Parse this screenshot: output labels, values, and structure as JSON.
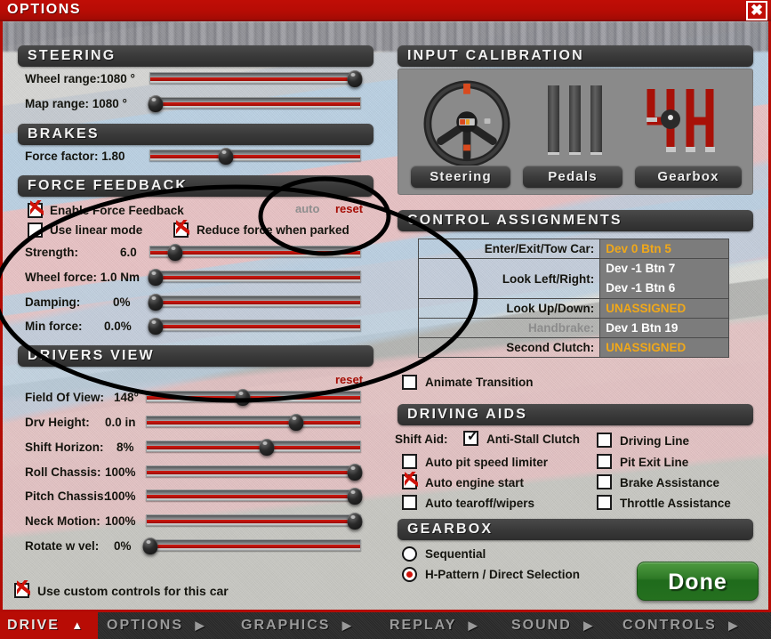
{
  "window": {
    "title": "OPTIONS",
    "close_label": "✖"
  },
  "steering": {
    "header": "STEERING",
    "rows": [
      {
        "label": "Wheel range:1080 °",
        "value": 100
      },
      {
        "label": "Map range:   1080 °",
        "value": 2
      }
    ]
  },
  "brakes": {
    "header": "BRAKES",
    "rows": [
      {
        "label": "Force factor:   1.80",
        "value": 38
      }
    ]
  },
  "force_feedback": {
    "header": "FORCE FEEDBACK",
    "auto_label": "auto",
    "reset_label": "reset",
    "checkboxes": [
      {
        "label": "Enable Force Feedback",
        "checked": true
      },
      {
        "label": "Use linear mode",
        "checked": false
      },
      {
        "label": "Reduce force when parked",
        "checked": true
      }
    ],
    "rows": [
      {
        "label": "Strength:",
        "value_text": "6.0",
        "value": 13
      },
      {
        "label": "Wheel force: 1.0 Nm",
        "value_text": "",
        "value": 2
      },
      {
        "label": "Damping:",
        "value_text": "0%",
        "value": 2
      },
      {
        "label": "Min force:",
        "value_text": "0.0%",
        "value": 2
      }
    ]
  },
  "drivers_view": {
    "header": "DRIVERS VIEW",
    "reset_label": "reset",
    "rows": [
      {
        "label": "Field Of View:",
        "value_text": "148°",
        "value": 45
      },
      {
        "label": "Drv Height:",
        "value_text": "0.0 in",
        "value": 71
      },
      {
        "label": "Shift Horizon:",
        "value_text": "8%",
        "value": 57
      },
      {
        "label": "Roll Chassis:",
        "value_text": "100%",
        "value": 99
      },
      {
        "label": "Pitch Chassis:",
        "value_text": "100%",
        "value": 99
      },
      {
        "label": "Neck Motion:",
        "value_text": "100%",
        "value": 99
      },
      {
        "label": "Rotate w vel:",
        "value_text": "0%",
        "value": 2
      }
    ]
  },
  "custom_controls": {
    "label": "Use custom controls for this car",
    "checked": true
  },
  "input_calibration": {
    "header": "INPUT CALIBRATION",
    "buttons": [
      {
        "label": "Steering",
        "icon": "steering-wheel-icon"
      },
      {
        "label": "Pedals",
        "icon": "pedals-icon"
      },
      {
        "label": "Gearbox",
        "icon": "gearbox-h-pattern-icon"
      }
    ]
  },
  "control_assignments": {
    "header": "CONTROL ASSIGNMENTS",
    "rows": [
      {
        "key": "Enter/Exit/Tow Car:",
        "value": "Dev 0 Btn 5",
        "style": "highlight",
        "key_dim": false
      },
      {
        "key": "Look Left/Right:",
        "value": "Dev -1 Btn 7",
        "value2": "Dev -1 Btn 6",
        "style": "normal",
        "key_dim": false
      },
      {
        "key": "Look Up/Down:",
        "value": "UNASSIGNED",
        "style": "unassigned",
        "key_dim": false
      },
      {
        "key": "Handbrake:",
        "value": "Dev 1 Btn 19",
        "style": "normal",
        "key_dim": true
      },
      {
        "key": "Second Clutch:",
        "value": "UNASSIGNED",
        "style": "unassigned",
        "key_dim": false
      }
    ],
    "animate_transition": {
      "label": "Animate Transition",
      "checked": false
    }
  },
  "driving_aids": {
    "header": "DRIVING AIDS",
    "shift_aid_label": "Shift Aid:",
    "left_column": [
      {
        "label": "Anti-Stall Clutch",
        "checked": true,
        "dark_check": true
      },
      {
        "label": "Auto pit speed limiter",
        "checked": false
      },
      {
        "label": "Auto engine start",
        "checked": true
      },
      {
        "label": "Auto tearoff/wipers",
        "checked": false
      }
    ],
    "right_column": [
      {
        "label": "Driving Line",
        "checked": false
      },
      {
        "label": "Pit Exit Line",
        "checked": false
      },
      {
        "label": "Brake Assistance",
        "checked": false
      },
      {
        "label": "Throttle Assistance",
        "checked": false
      }
    ]
  },
  "gearbox": {
    "header": "GEARBOX",
    "options": [
      {
        "label": "Sequential",
        "selected": false
      },
      {
        "label": "H-Pattern / Direct Selection",
        "selected": true
      }
    ]
  },
  "done_button": {
    "label": "Done"
  },
  "bottom_nav": {
    "items": [
      {
        "label": "DRIVE",
        "arrow": "▲",
        "active": true
      },
      {
        "label": "OPTIONS",
        "arrow": "▶",
        "active": false
      },
      {
        "label": "GRAPHICS",
        "arrow": "▶",
        "active": false
      },
      {
        "label": "REPLAY",
        "arrow": "▶",
        "active": false
      },
      {
        "label": "SOUND",
        "arrow": "▶",
        "active": false
      },
      {
        "label": "CONTROLS",
        "arrow": "▶",
        "active": false
      }
    ]
  },
  "colors": {
    "brand_red": "#b30c05",
    "header_dark": "#333333",
    "accent_amber": "#f0a81a",
    "done_green": "#2f7a27",
    "slider_red": "#c01209"
  }
}
